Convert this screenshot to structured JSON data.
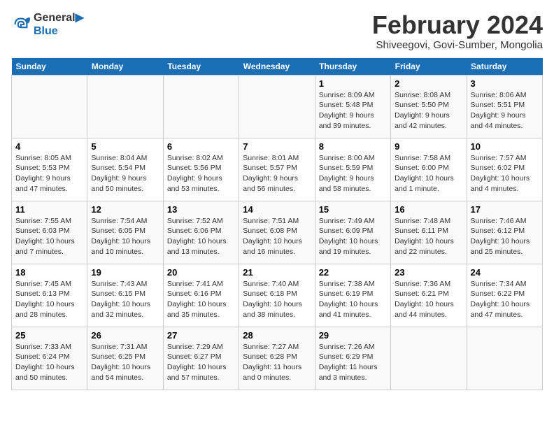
{
  "header": {
    "logo_line1": "General",
    "logo_line2": "Blue",
    "month_title": "February 2024",
    "subtitle": "Shiveegovi, Govi-Sumber, Mongolia"
  },
  "days_of_week": [
    "Sunday",
    "Monday",
    "Tuesday",
    "Wednesday",
    "Thursday",
    "Friday",
    "Saturday"
  ],
  "weeks": [
    [
      {
        "day": "",
        "info": ""
      },
      {
        "day": "",
        "info": ""
      },
      {
        "day": "",
        "info": ""
      },
      {
        "day": "",
        "info": ""
      },
      {
        "day": "1",
        "info": "Sunrise: 8:09 AM\nSunset: 5:48 PM\nDaylight: 9 hours and 39 minutes."
      },
      {
        "day": "2",
        "info": "Sunrise: 8:08 AM\nSunset: 5:50 PM\nDaylight: 9 hours and 42 minutes."
      },
      {
        "day": "3",
        "info": "Sunrise: 8:06 AM\nSunset: 5:51 PM\nDaylight: 9 hours and 44 minutes."
      }
    ],
    [
      {
        "day": "4",
        "info": "Sunrise: 8:05 AM\nSunset: 5:53 PM\nDaylight: 9 hours and 47 minutes."
      },
      {
        "day": "5",
        "info": "Sunrise: 8:04 AM\nSunset: 5:54 PM\nDaylight: 9 hours and 50 minutes."
      },
      {
        "day": "6",
        "info": "Sunrise: 8:02 AM\nSunset: 5:56 PM\nDaylight: 9 hours and 53 minutes."
      },
      {
        "day": "7",
        "info": "Sunrise: 8:01 AM\nSunset: 5:57 PM\nDaylight: 9 hours and 56 minutes."
      },
      {
        "day": "8",
        "info": "Sunrise: 8:00 AM\nSunset: 5:59 PM\nDaylight: 9 hours and 58 minutes."
      },
      {
        "day": "9",
        "info": "Sunrise: 7:58 AM\nSunset: 6:00 PM\nDaylight: 10 hours and 1 minute."
      },
      {
        "day": "10",
        "info": "Sunrise: 7:57 AM\nSunset: 6:02 PM\nDaylight: 10 hours and 4 minutes."
      }
    ],
    [
      {
        "day": "11",
        "info": "Sunrise: 7:55 AM\nSunset: 6:03 PM\nDaylight: 10 hours and 7 minutes."
      },
      {
        "day": "12",
        "info": "Sunrise: 7:54 AM\nSunset: 6:05 PM\nDaylight: 10 hours and 10 minutes."
      },
      {
        "day": "13",
        "info": "Sunrise: 7:52 AM\nSunset: 6:06 PM\nDaylight: 10 hours and 13 minutes."
      },
      {
        "day": "14",
        "info": "Sunrise: 7:51 AM\nSunset: 6:08 PM\nDaylight: 10 hours and 16 minutes."
      },
      {
        "day": "15",
        "info": "Sunrise: 7:49 AM\nSunset: 6:09 PM\nDaylight: 10 hours and 19 minutes."
      },
      {
        "day": "16",
        "info": "Sunrise: 7:48 AM\nSunset: 6:11 PM\nDaylight: 10 hours and 22 minutes."
      },
      {
        "day": "17",
        "info": "Sunrise: 7:46 AM\nSunset: 6:12 PM\nDaylight: 10 hours and 25 minutes."
      }
    ],
    [
      {
        "day": "18",
        "info": "Sunrise: 7:45 AM\nSunset: 6:13 PM\nDaylight: 10 hours and 28 minutes."
      },
      {
        "day": "19",
        "info": "Sunrise: 7:43 AM\nSunset: 6:15 PM\nDaylight: 10 hours and 32 minutes."
      },
      {
        "day": "20",
        "info": "Sunrise: 7:41 AM\nSunset: 6:16 PM\nDaylight: 10 hours and 35 minutes."
      },
      {
        "day": "21",
        "info": "Sunrise: 7:40 AM\nSunset: 6:18 PM\nDaylight: 10 hours and 38 minutes."
      },
      {
        "day": "22",
        "info": "Sunrise: 7:38 AM\nSunset: 6:19 PM\nDaylight: 10 hours and 41 minutes."
      },
      {
        "day": "23",
        "info": "Sunrise: 7:36 AM\nSunset: 6:21 PM\nDaylight: 10 hours and 44 minutes."
      },
      {
        "day": "24",
        "info": "Sunrise: 7:34 AM\nSunset: 6:22 PM\nDaylight: 10 hours and 47 minutes."
      }
    ],
    [
      {
        "day": "25",
        "info": "Sunrise: 7:33 AM\nSunset: 6:24 PM\nDaylight: 10 hours and 50 minutes."
      },
      {
        "day": "26",
        "info": "Sunrise: 7:31 AM\nSunset: 6:25 PM\nDaylight: 10 hours and 54 minutes."
      },
      {
        "day": "27",
        "info": "Sunrise: 7:29 AM\nSunset: 6:27 PM\nDaylight: 10 hours and 57 minutes."
      },
      {
        "day": "28",
        "info": "Sunrise: 7:27 AM\nSunset: 6:28 PM\nDaylight: 11 hours and 0 minutes."
      },
      {
        "day": "29",
        "info": "Sunrise: 7:26 AM\nSunset: 6:29 PM\nDaylight: 11 hours and 3 minutes."
      },
      {
        "day": "",
        "info": ""
      },
      {
        "day": "",
        "info": ""
      }
    ]
  ]
}
